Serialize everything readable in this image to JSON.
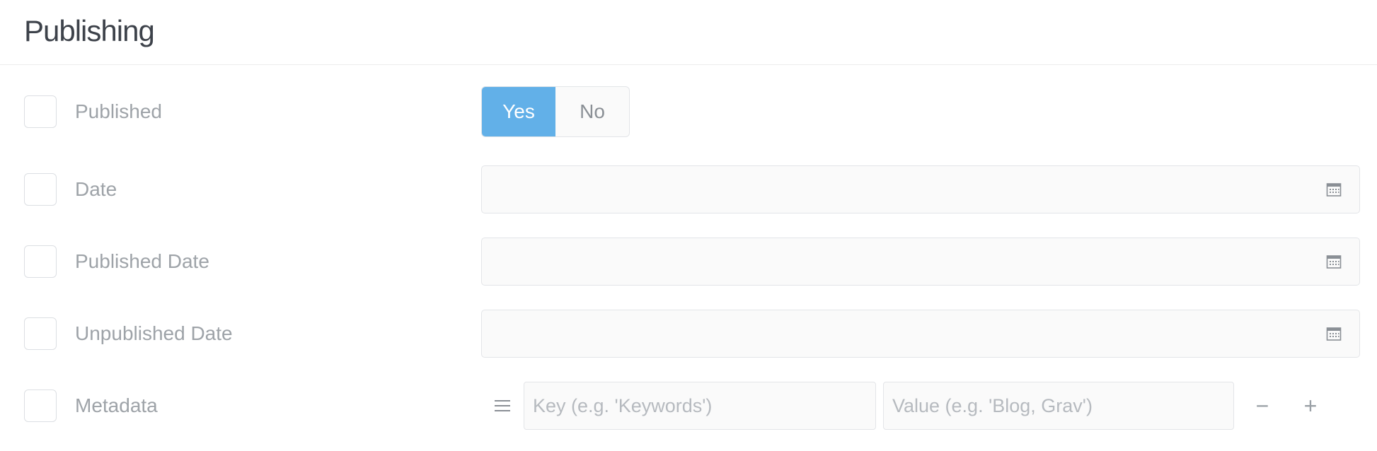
{
  "section": {
    "title": "Publishing"
  },
  "fields": {
    "published": {
      "label": "Published",
      "options": [
        "Yes",
        "No"
      ],
      "selected": "Yes"
    },
    "date": {
      "label": "Date",
      "value": ""
    },
    "published_date": {
      "label": "Published Date",
      "value": ""
    },
    "unpublished_date": {
      "label": "Unpublished Date",
      "value": ""
    },
    "metadata": {
      "label": "Metadata",
      "key_placeholder": "Key (e.g. 'Keywords')",
      "value_placeholder": "Value (e.g. 'Blog, Grav')",
      "remove_label": "−",
      "add_label": "+"
    }
  },
  "icons": {
    "calendar": "calendar-icon",
    "drag": "drag-handle-icon"
  },
  "colors": {
    "accent": "#62b0e8",
    "title": "#3d424a",
    "label": "#9ea3a8"
  }
}
